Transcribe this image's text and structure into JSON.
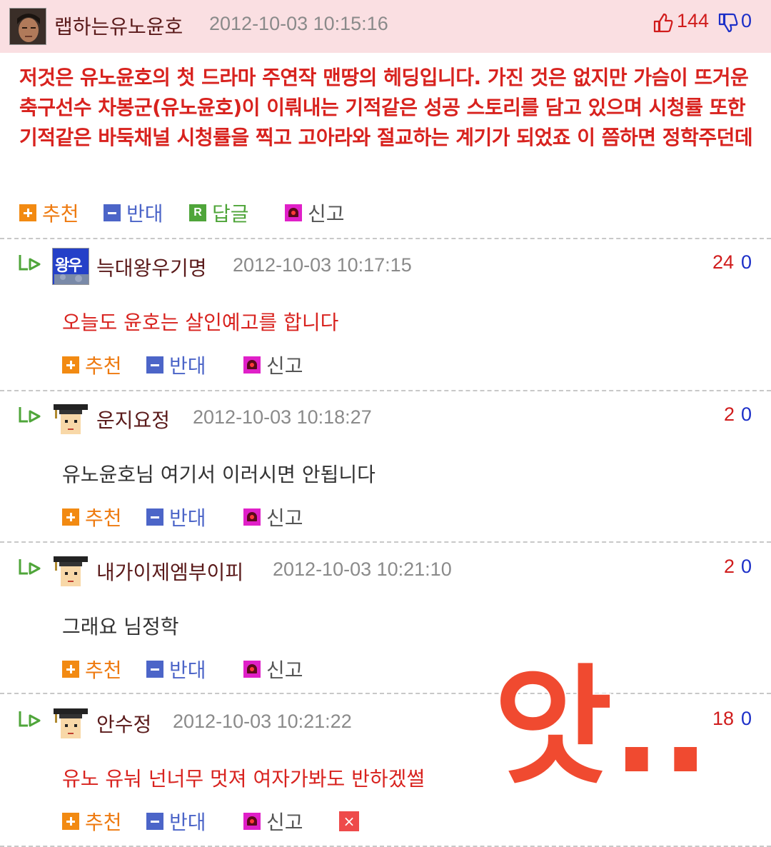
{
  "post": {
    "author": "랩하는유노윤호",
    "date": "2012-10-03 10:15:16",
    "up": "144",
    "down": "0",
    "text": "저것은 유노윤호의 첫 드라마 주연작 맨땅의 헤딩입니다. 가진 것은 없지만 가슴이 뜨거운 축구선수 차봉군(유노윤호)이 이뤄내는 기적같은 성공 스토리를 담고 있으며 시청률 또한 기적같은 바둑채널 시청률을 찍고 고아라와 절교하는 계기가 되었죠 이 쯤하면 정학주던데",
    "actions": {
      "recommend": "추천",
      "oppose": "반대",
      "reply": "답글",
      "reply_icon": "R",
      "report": "신고"
    }
  },
  "comments": [
    {
      "author": "늑대왕우기명",
      "date": "2012-10-03 10:17:15",
      "up": "24",
      "down": "0",
      "text": "오늘도 윤호는 살인예고를 합니다",
      "avatar_text": "왕우"
    },
    {
      "author": "운지요정",
      "date": "2012-10-03 10:18:27",
      "up": "2",
      "down": "0",
      "text": "유노윤호님 여기서 이러시면 안됩니다"
    },
    {
      "author": "내가이제엠부이피",
      "date": "2012-10-03 10:21:10",
      "up": "2",
      "down": "0",
      "text": "그래요 님정학"
    },
    {
      "author": "안수정",
      "date": "2012-10-03 10:21:22",
      "up": "18",
      "down": "0",
      "text": "유노 유눠 넌너무 멋져 여자가봐도 반하겠썰"
    }
  ],
  "comment_actions": {
    "recommend": "추천",
    "oppose": "반대",
    "report": "신고"
  },
  "close_glyph": "×",
  "overlay_text": "앗..",
  "colors": {
    "header_bg": "#fadfe2",
    "red_text": "#d8221e",
    "upvote": "#d01c1c",
    "downvote": "#1c2fc8",
    "recommend": "#f28a12",
    "oppose": "#4c65c8",
    "reply": "#4fa53a",
    "report": "#e020c8",
    "overlay": "#f04a30"
  },
  "icons": [
    "thumbs-up-icon",
    "thumbs-down-icon",
    "plus-icon",
    "minus-icon",
    "reply-icon",
    "siren-icon",
    "reply-arrow-icon",
    "close-icon"
  ]
}
